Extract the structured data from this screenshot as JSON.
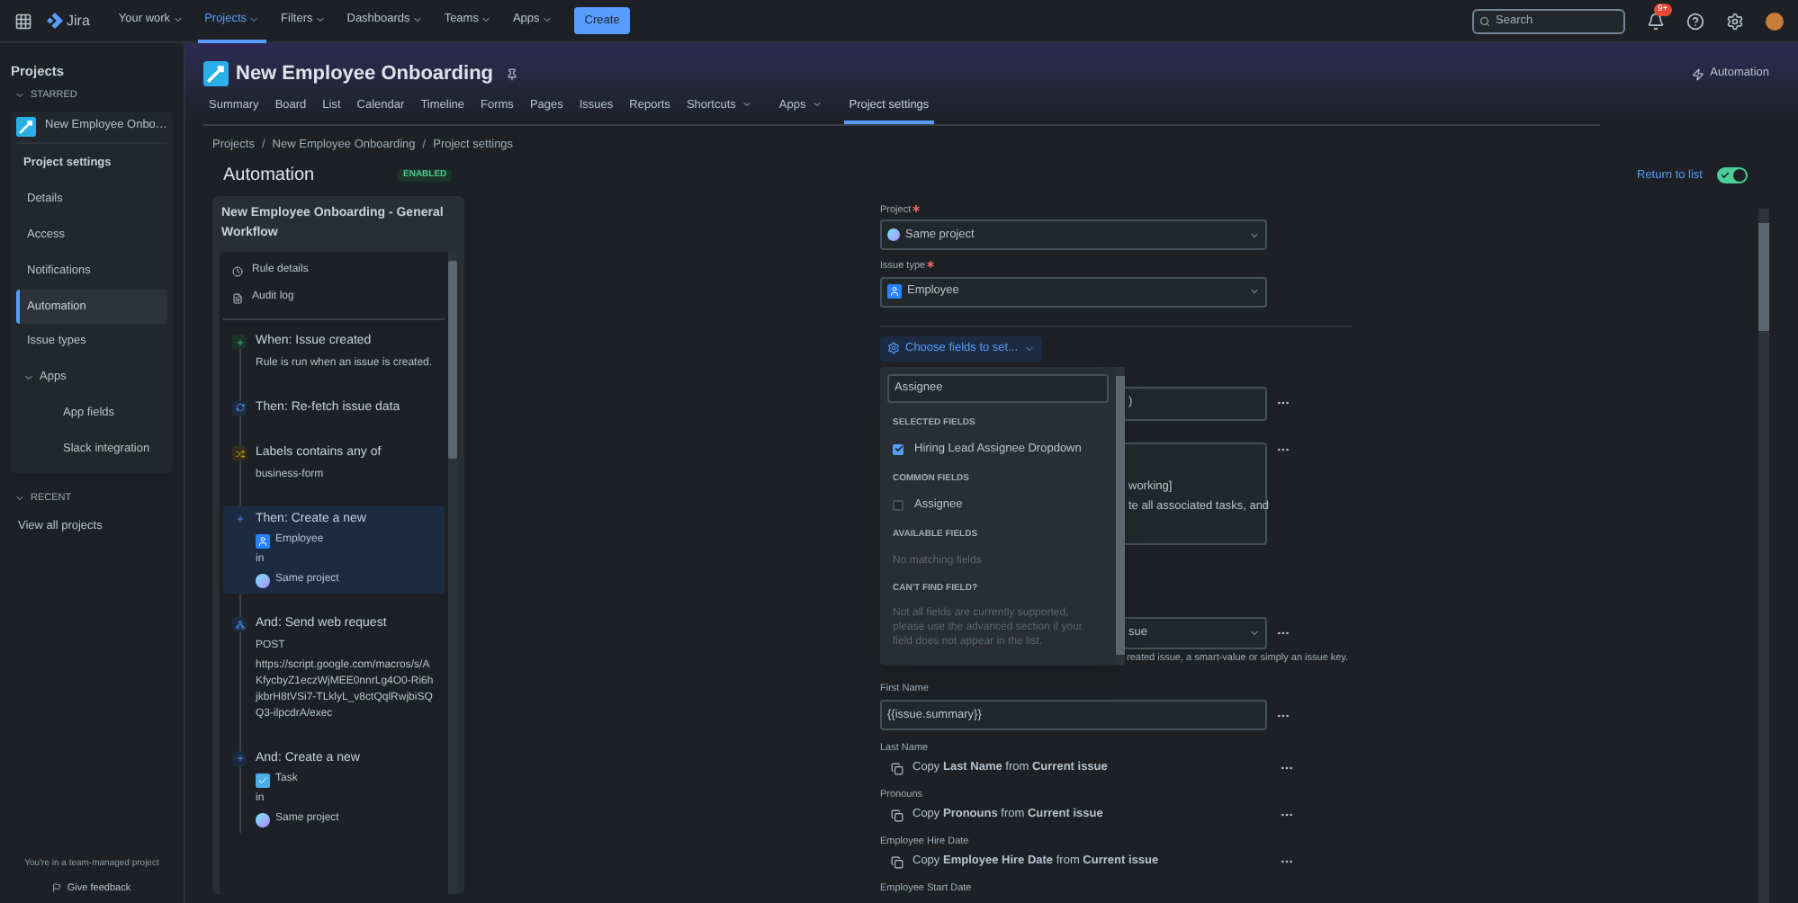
{
  "top_nav": {
    "product": "Jira",
    "items": [
      {
        "label": "Your work",
        "selected": false
      },
      {
        "label": "Projects",
        "selected": true
      },
      {
        "label": "Filters",
        "selected": false
      },
      {
        "label": "Dashboards",
        "selected": false
      },
      {
        "label": "Teams",
        "selected": false
      },
      {
        "label": "Apps",
        "selected": false
      }
    ],
    "create_button": "Create",
    "search": {
      "placeholder": "Search"
    },
    "notification_badge": "9+"
  },
  "sidebar": {
    "title": "Projects",
    "starred": {
      "label": "STARRED",
      "expanded": true
    },
    "project": "New Employee Onbo…",
    "section_title": "Project settings",
    "items": [
      {
        "label": "Details",
        "selected": false
      },
      {
        "label": "Access",
        "selected": false
      },
      {
        "label": "Notifications",
        "selected": false
      },
      {
        "label": "Automation",
        "selected": true
      },
      {
        "label": "Issue types",
        "selected": false
      },
      {
        "label": "Apps",
        "expanded": true,
        "children": [
          {
            "label": "App fields",
            "selected": false
          },
          {
            "label": "Slack integration",
            "selected": false
          }
        ]
      }
    ],
    "recent": {
      "label": "RECENT",
      "expanded": true
    },
    "view_all": "View all projects",
    "footer_note": "You're in a team-managed project",
    "feedback": "Give feedback"
  },
  "project_header": {
    "title": "New Employee Onboarding",
    "automation_link": "Automation",
    "tabs": [
      {
        "label": "Summary",
        "selected": false
      },
      {
        "label": "Board",
        "selected": false
      },
      {
        "label": "List",
        "selected": false
      },
      {
        "label": "Calendar",
        "selected": false
      },
      {
        "label": "Timeline",
        "selected": false
      },
      {
        "label": "Forms",
        "selected": false
      },
      {
        "label": "Pages",
        "selected": false
      },
      {
        "label": "Issues",
        "selected": false
      },
      {
        "label": "Reports",
        "selected": false
      },
      {
        "label": "Shortcuts",
        "selected": false,
        "menu": true
      },
      {
        "label": "Apps",
        "selected": false,
        "menu": true
      },
      {
        "label": "Project settings",
        "selected": true,
        "menu": false
      }
    ]
  },
  "breadcrumbs": {
    "separator": "/",
    "items": [
      "Projects",
      "New Employee Onboarding",
      "Project settings"
    ]
  },
  "page": {
    "title": "Automation",
    "status": "ENABLED",
    "return_link": "Return to list",
    "rule_enabled": true
  },
  "rule": {
    "name": "New Employee Onboarding - General Workflow",
    "links": [
      "Rule details",
      "Audit log"
    ],
    "steps": [
      {
        "kind": "trigger",
        "title": "When: Issue created",
        "lines": [
          "Rule is run when an issue is created."
        ],
        "selected": false
      },
      {
        "kind": "refetch",
        "title": "Then: Re-fetch issue data",
        "selected": false
      },
      {
        "kind": "condition",
        "title": "Labels contains any of",
        "lines": [
          "business-form"
        ],
        "selected": false
      },
      {
        "kind": "create",
        "title": "Then: Create a new",
        "issue_type": {
          "kind": "employee",
          "label": "Employee"
        },
        "in": "in",
        "project": "Same project",
        "selected": true
      },
      {
        "kind": "webrequest",
        "title": "And: Send web request",
        "lines": [
          "POST",
          "https://script.google.com/macros/s/AKfycbyZ1eczWjMEE0nnrLg4O0-Ri6hjkbrH8tVSi7-TLklyL_v8ctQqlRwjbiSQQ3-ilpcdrA/exec"
        ],
        "selected": false
      },
      {
        "kind": "create",
        "title": "And: Create a new",
        "issue_type": {
          "kind": "task",
          "label": "Task"
        },
        "in": "in",
        "project": "Same project",
        "selected": false
      }
    ]
  },
  "form": {
    "project": {
      "label": "Project",
      "required": true,
      "value": "Same project"
    },
    "issue_type": {
      "label": "Issue type",
      "required": true,
      "value": "Employee"
    },
    "choose_button": "Choose fields to set...",
    "covered": {
      "field_fragment": ")",
      "textarea_lines": [
        "working]",
        "te all associated tasks, and"
      ],
      "select_fragment": "sue",
      "helper_fragment": "reated issue, a smart-value or simply an issue key."
    },
    "fields": [
      {
        "kind": "input",
        "label": "First Name",
        "value": "{{issue.summary}}"
      },
      {
        "kind": "copy",
        "label": "Last Name",
        "value": "Copy **Last Name** from **Current issue**"
      },
      {
        "kind": "copy",
        "label": "Pronouns",
        "value": "Copy **Pronouns** from **Current issue**"
      },
      {
        "kind": "copy",
        "label": "Employee Hire Date",
        "value": "Copy **Employee Hire Date** from **Current issue**"
      },
      {
        "kind": "label",
        "label": "Employee Start Date"
      }
    ]
  },
  "field_picker": {
    "search_value": "Assignee",
    "sections": [
      {
        "title": "SELECTED FIELDS",
        "options": [
          {
            "label": "Hiring Lead Assignee Dropdown",
            "checked": true
          }
        ]
      },
      {
        "title": "COMMON FIELDS",
        "options": [
          {
            "label": "Assignee",
            "checked": false
          }
        ]
      },
      {
        "title": "AVAILABLE FIELDS",
        "note": "No matching fields"
      },
      {
        "title": "CAN'T FIND FIELD?",
        "note": "Not all fields are currently supported, please use the advanced section if your field does not appear in the list."
      }
    ]
  }
}
